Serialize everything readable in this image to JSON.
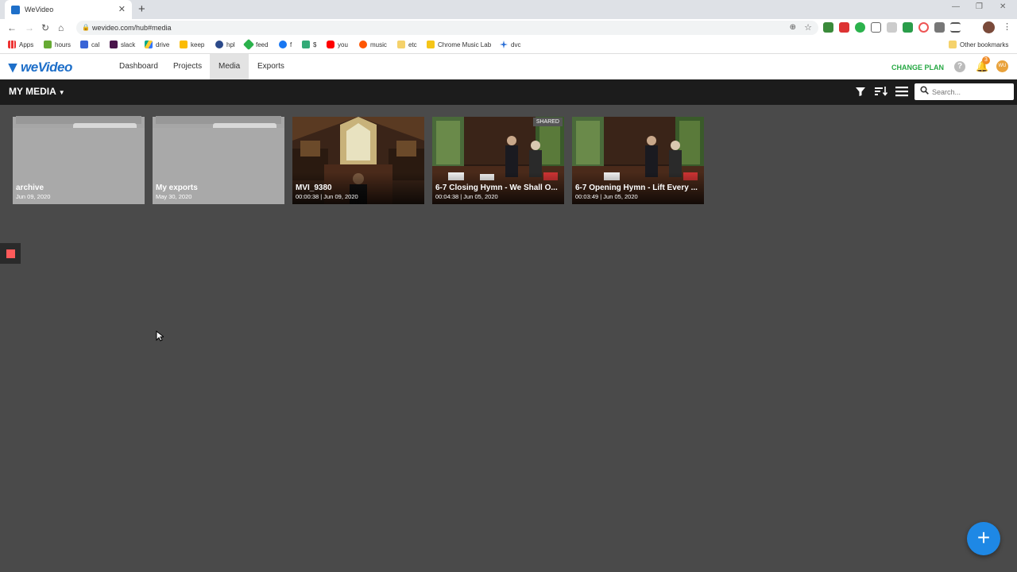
{
  "browser": {
    "tab_title": "WeVideo",
    "url": "wevideo.com/hub#media",
    "bookmarks": [
      "Apps",
      "hours",
      "cal",
      "slack",
      "drive",
      "keep",
      "hpl",
      "feed",
      "f",
      "$",
      "you",
      "music",
      "etc",
      "Chrome Music Lab",
      "dvc"
    ],
    "other_bookmarks": "Other bookmarks"
  },
  "app": {
    "logo": "weVideo",
    "nav": [
      "Dashboard",
      "Projects",
      "Media",
      "Exports"
    ],
    "active_nav": "Media",
    "change_plan": "CHANGE PLAN",
    "notification_count": "3",
    "avatar_initials": "WU"
  },
  "toolbar": {
    "title": "MY MEDIA",
    "search_placeholder": "Search..."
  },
  "media": [
    {
      "name": "archive",
      "meta": "Jun 09, 2020",
      "kind": "folder"
    },
    {
      "name": "My exports",
      "meta": "May 30, 2020",
      "kind": "folder"
    },
    {
      "name": "MVI_9380",
      "meta": "00:00:38 | Jun 09, 2020",
      "kind": "video"
    },
    {
      "name": "6-7 Closing Hymn - We Shall O...",
      "meta": "00:04:38 | Jun 05, 2020",
      "kind": "video",
      "badge": "SHARED"
    },
    {
      "name": "6-7 Opening Hymn - Lift Every ...",
      "meta": "00:03:49 | Jun 05, 2020",
      "kind": "video"
    }
  ],
  "colors": {
    "accent": "#1e6fc9",
    "change_plan": "#27a844",
    "fab": "#1e88e5",
    "background": "#4a4a4a"
  }
}
